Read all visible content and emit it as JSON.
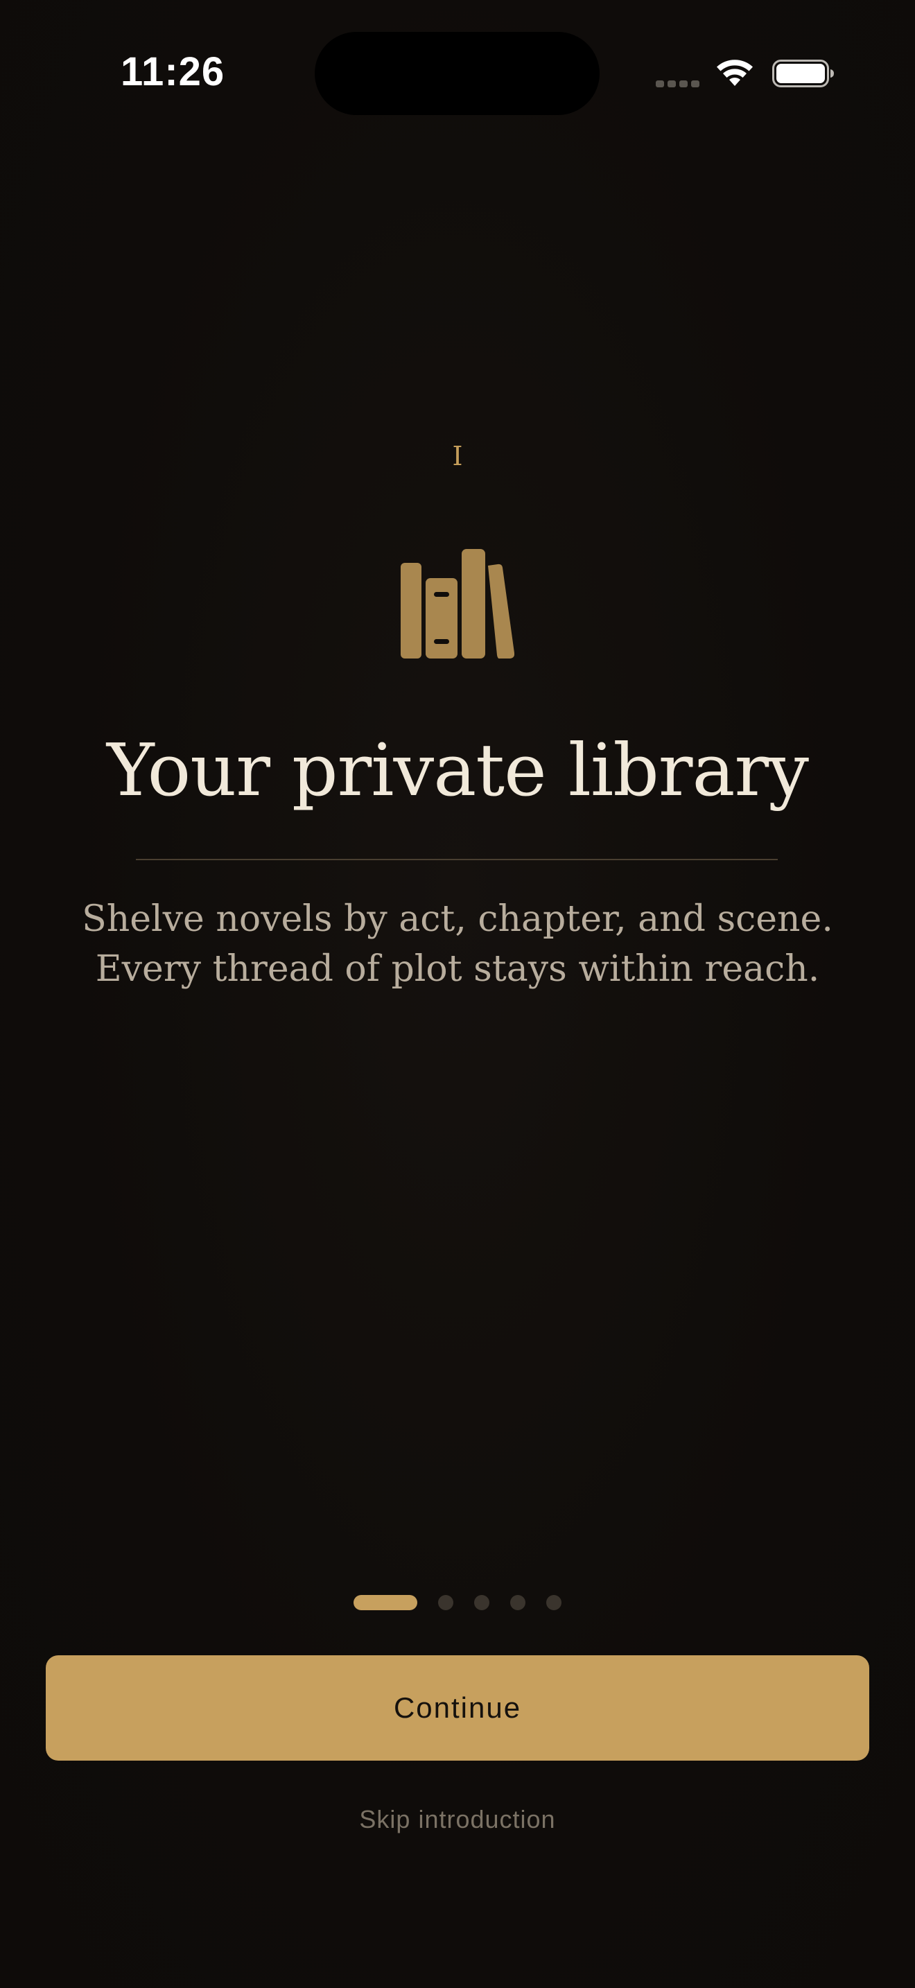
{
  "status_bar": {
    "time": "11:26"
  },
  "onboarding": {
    "chapter_numeral": "I",
    "icon": "books-icon",
    "title": "Your private library",
    "description_lines": [
      "Shelve novels by act, chapter, and scene.",
      "Every thread of plot stays within reach."
    ],
    "page_index": 1,
    "page_count": 5,
    "continue_label": "Continue",
    "skip_label": "Skip introduction"
  },
  "colors": {
    "background": "#100d0b",
    "accent": "#c7a05e",
    "title": "#f1e9da",
    "body_text": "#b8ad9d",
    "muted": "#7b7265",
    "inactive_dot": "#3a342d"
  }
}
